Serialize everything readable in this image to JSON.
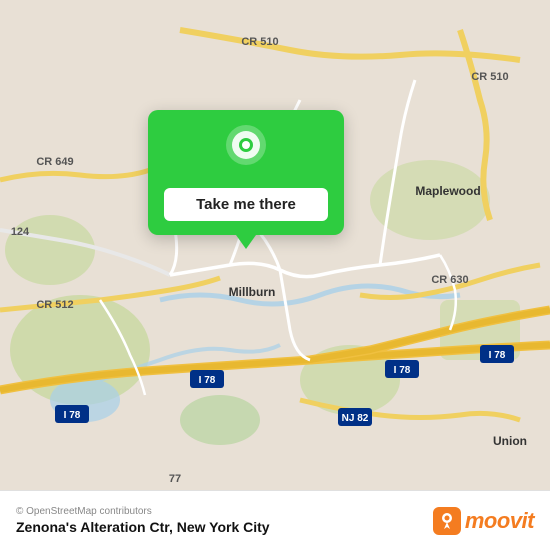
{
  "map": {
    "alt": "Map of Millburn, New Jersey area",
    "attribution": "© OpenStreetMap contributors",
    "roads": {
      "cr510": "CR 510",
      "cr649": "CR 649",
      "cr630": "CR 630",
      "cr512": "CR 512",
      "i78a": "I 78",
      "i78b": "I 78",
      "nj82": "NJ 82",
      "r77": "77",
      "r124": "124"
    },
    "places": {
      "millburn": "Millburn",
      "maplewood": "Maplewood",
      "union": "Union"
    }
  },
  "popup": {
    "button_label": "Take me there",
    "icon": "location-pin-icon"
  },
  "footer": {
    "attribution": "© OpenStreetMap contributors",
    "title": "Zenona's Alteration Ctr, New York City",
    "logo_text": "moovit"
  }
}
